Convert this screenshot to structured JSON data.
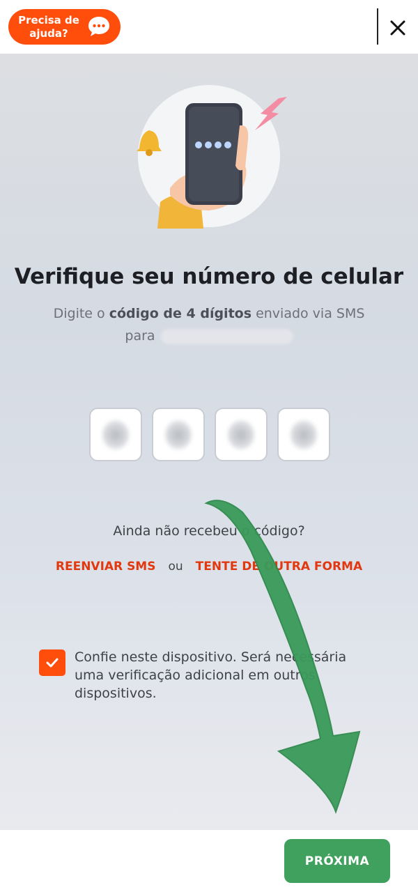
{
  "header": {
    "help_label": "Precisa de ajuda?",
    "help_icon": "chat-bubble-icon",
    "close_icon": "close-icon"
  },
  "hero": {
    "illustration": "phone-in-hand-illustration"
  },
  "main": {
    "title": "Verifique seu número de celular",
    "subtitle_prefix": "Digite o",
    "subtitle_bold": "código de 4 dígitos",
    "subtitle_suffix": "enviado via SMS",
    "subtitle_to": "para",
    "code_boxes": 4
  },
  "resend": {
    "question": "Ainda não recebeu o código?",
    "resend_sms": "REENVIAR SMS",
    "or": "ou",
    "try_other": "TENTE DE OUTRA FORMA"
  },
  "trust": {
    "checked": true,
    "label": "Confie neste dispositivo. Será necessária uma verificação adicional em outros dispositivos."
  },
  "footer": {
    "next_label": "PRÓXIMA"
  },
  "colors": {
    "accent": "#ff4e0b",
    "link": "#e1380f",
    "primary_button": "#3fa15d",
    "annotation_arrow": "#3a9a5a"
  }
}
